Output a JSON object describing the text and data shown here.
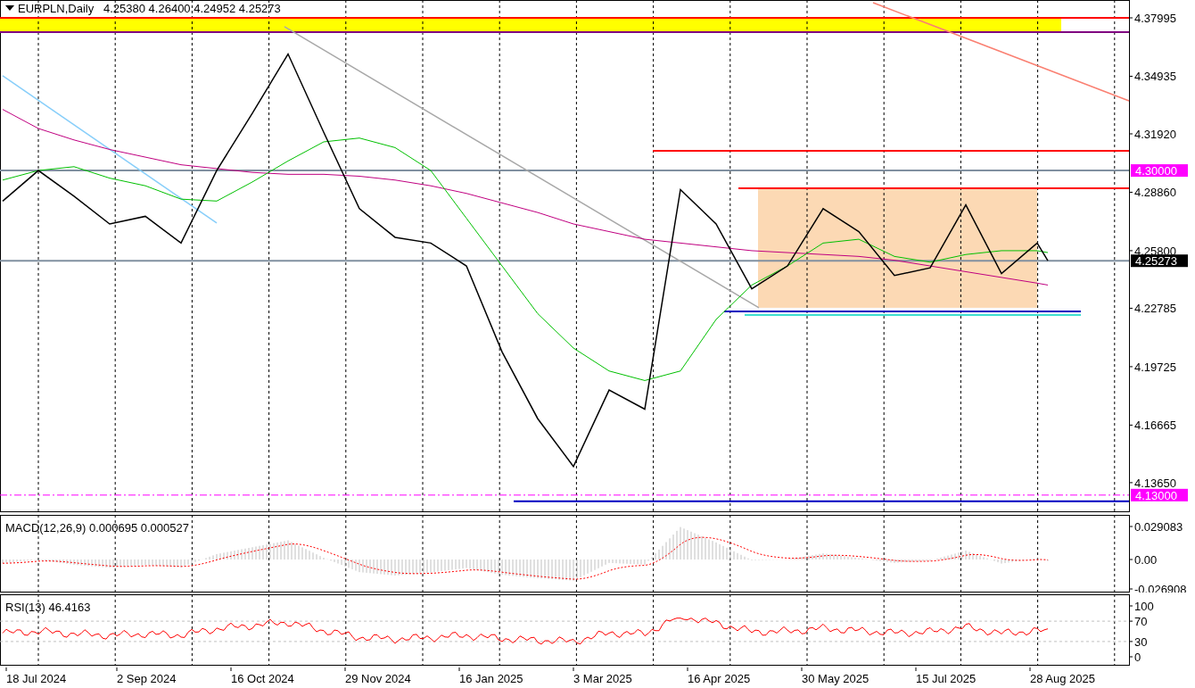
{
  "header": {
    "symbol": "EURPLN,Daily",
    "values": "4.25380 4.26400 4.24952 4.25273"
  },
  "price_axis": {
    "ticks": [
      "4.37995",
      "4.34935",
      "4.31920",
      "4.28860",
      "4.25800",
      "4.22785",
      "4.19725",
      "4.16665",
      "4.13650"
    ],
    "badges": [
      {
        "text": "4.30000",
        "kind": "level"
      },
      {
        "text": "4.25273",
        "kind": "current"
      },
      {
        "text": "4.13000",
        "kind": "level"
      }
    ]
  },
  "macd": {
    "title": "MACD(12,26,9) 0.000695 0.000527",
    "ticks": [
      "0.029083",
      "0.00",
      "-0.026908"
    ]
  },
  "rsi": {
    "title": "RSI(13) 46.4163",
    "ticks": [
      "100",
      "70",
      "30",
      "0"
    ]
  },
  "time_axis": {
    "labels": [
      "18 Jul 2024",
      "2 Sep 2024",
      "16 Oct 2024",
      "29 Nov 2024",
      "16 Jan 2025",
      "3 Mar 2025",
      "16 Apr 2025",
      "30 May 2025",
      "15 Jul 2025",
      "28 Aug 2025"
    ]
  }
}
